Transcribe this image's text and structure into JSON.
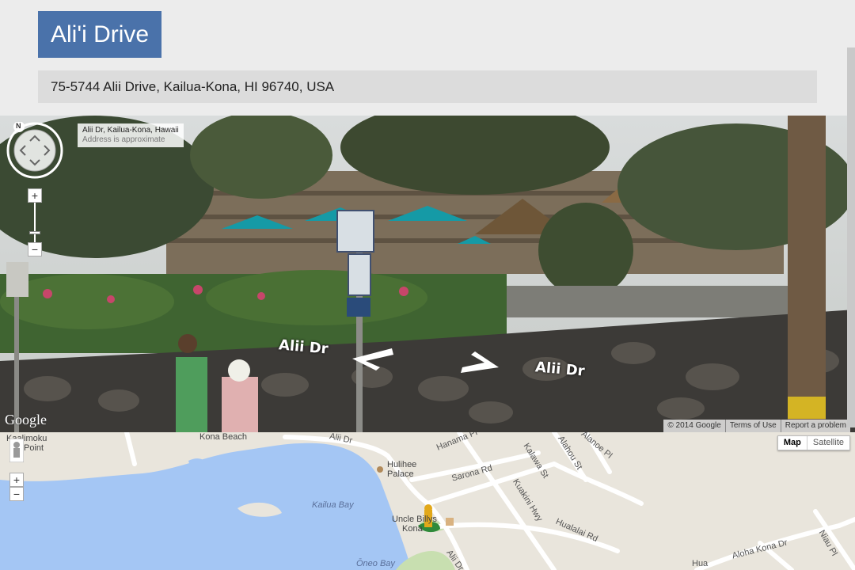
{
  "header": {
    "title": "Ali'i Drive",
    "address": "75-5744 Alii Drive, Kailua-Kona, HI 96740, USA"
  },
  "street_view": {
    "location_title": "Alii Dr, Kailua-Kona, Hawaii",
    "location_note": "Address is approximate",
    "compass_letter": "N",
    "zoom_in": "+",
    "zoom_out": "−",
    "road_label_left": "Alii Dr",
    "road_label_right": "Alii Dr",
    "logo": "Google",
    "copyright": "© 2014 Google",
    "terms": "Terms of Use",
    "report": "Report a problem"
  },
  "map": {
    "type_map": "Map",
    "type_satellite": "Satellite",
    "zoom_in": "+",
    "zoom_out": "−",
    "labels": {
      "kaalimoku": "Kaalimoku",
      "point": "Point",
      "kona_beach": "Kona Beach",
      "alii_dr_top": "Alii Dr",
      "hulihee_1": "Hulihee",
      "hulihee_2": "Palace",
      "hanama": "Hanama Pl",
      "sarona": "Sarona Rd",
      "kuakini": "Kuakini Hwy",
      "kalawa": "Kalawa St",
      "alahou": "Alahou St",
      "alanoe": "Alanoe Pl",
      "hualalai": "Hualalai Rd",
      "kailua_bay": "Kailua Bay",
      "uncle_billys_1": "Uncle Billys",
      "uncle_billys_2": "Kona",
      "alii_dr_bottom": "Alii Dr",
      "oneo_bay": "Ōneo Bay",
      "aloha_kona": "Aloha Kona Dr",
      "niau": "Niau Pl",
      "hua": "Hua"
    }
  },
  "colors": {
    "title_bg": "#4a72aa",
    "map_land": "#e9e5dc",
    "map_water": "#a4c6f4",
    "map_park": "#c8dfb0"
  }
}
